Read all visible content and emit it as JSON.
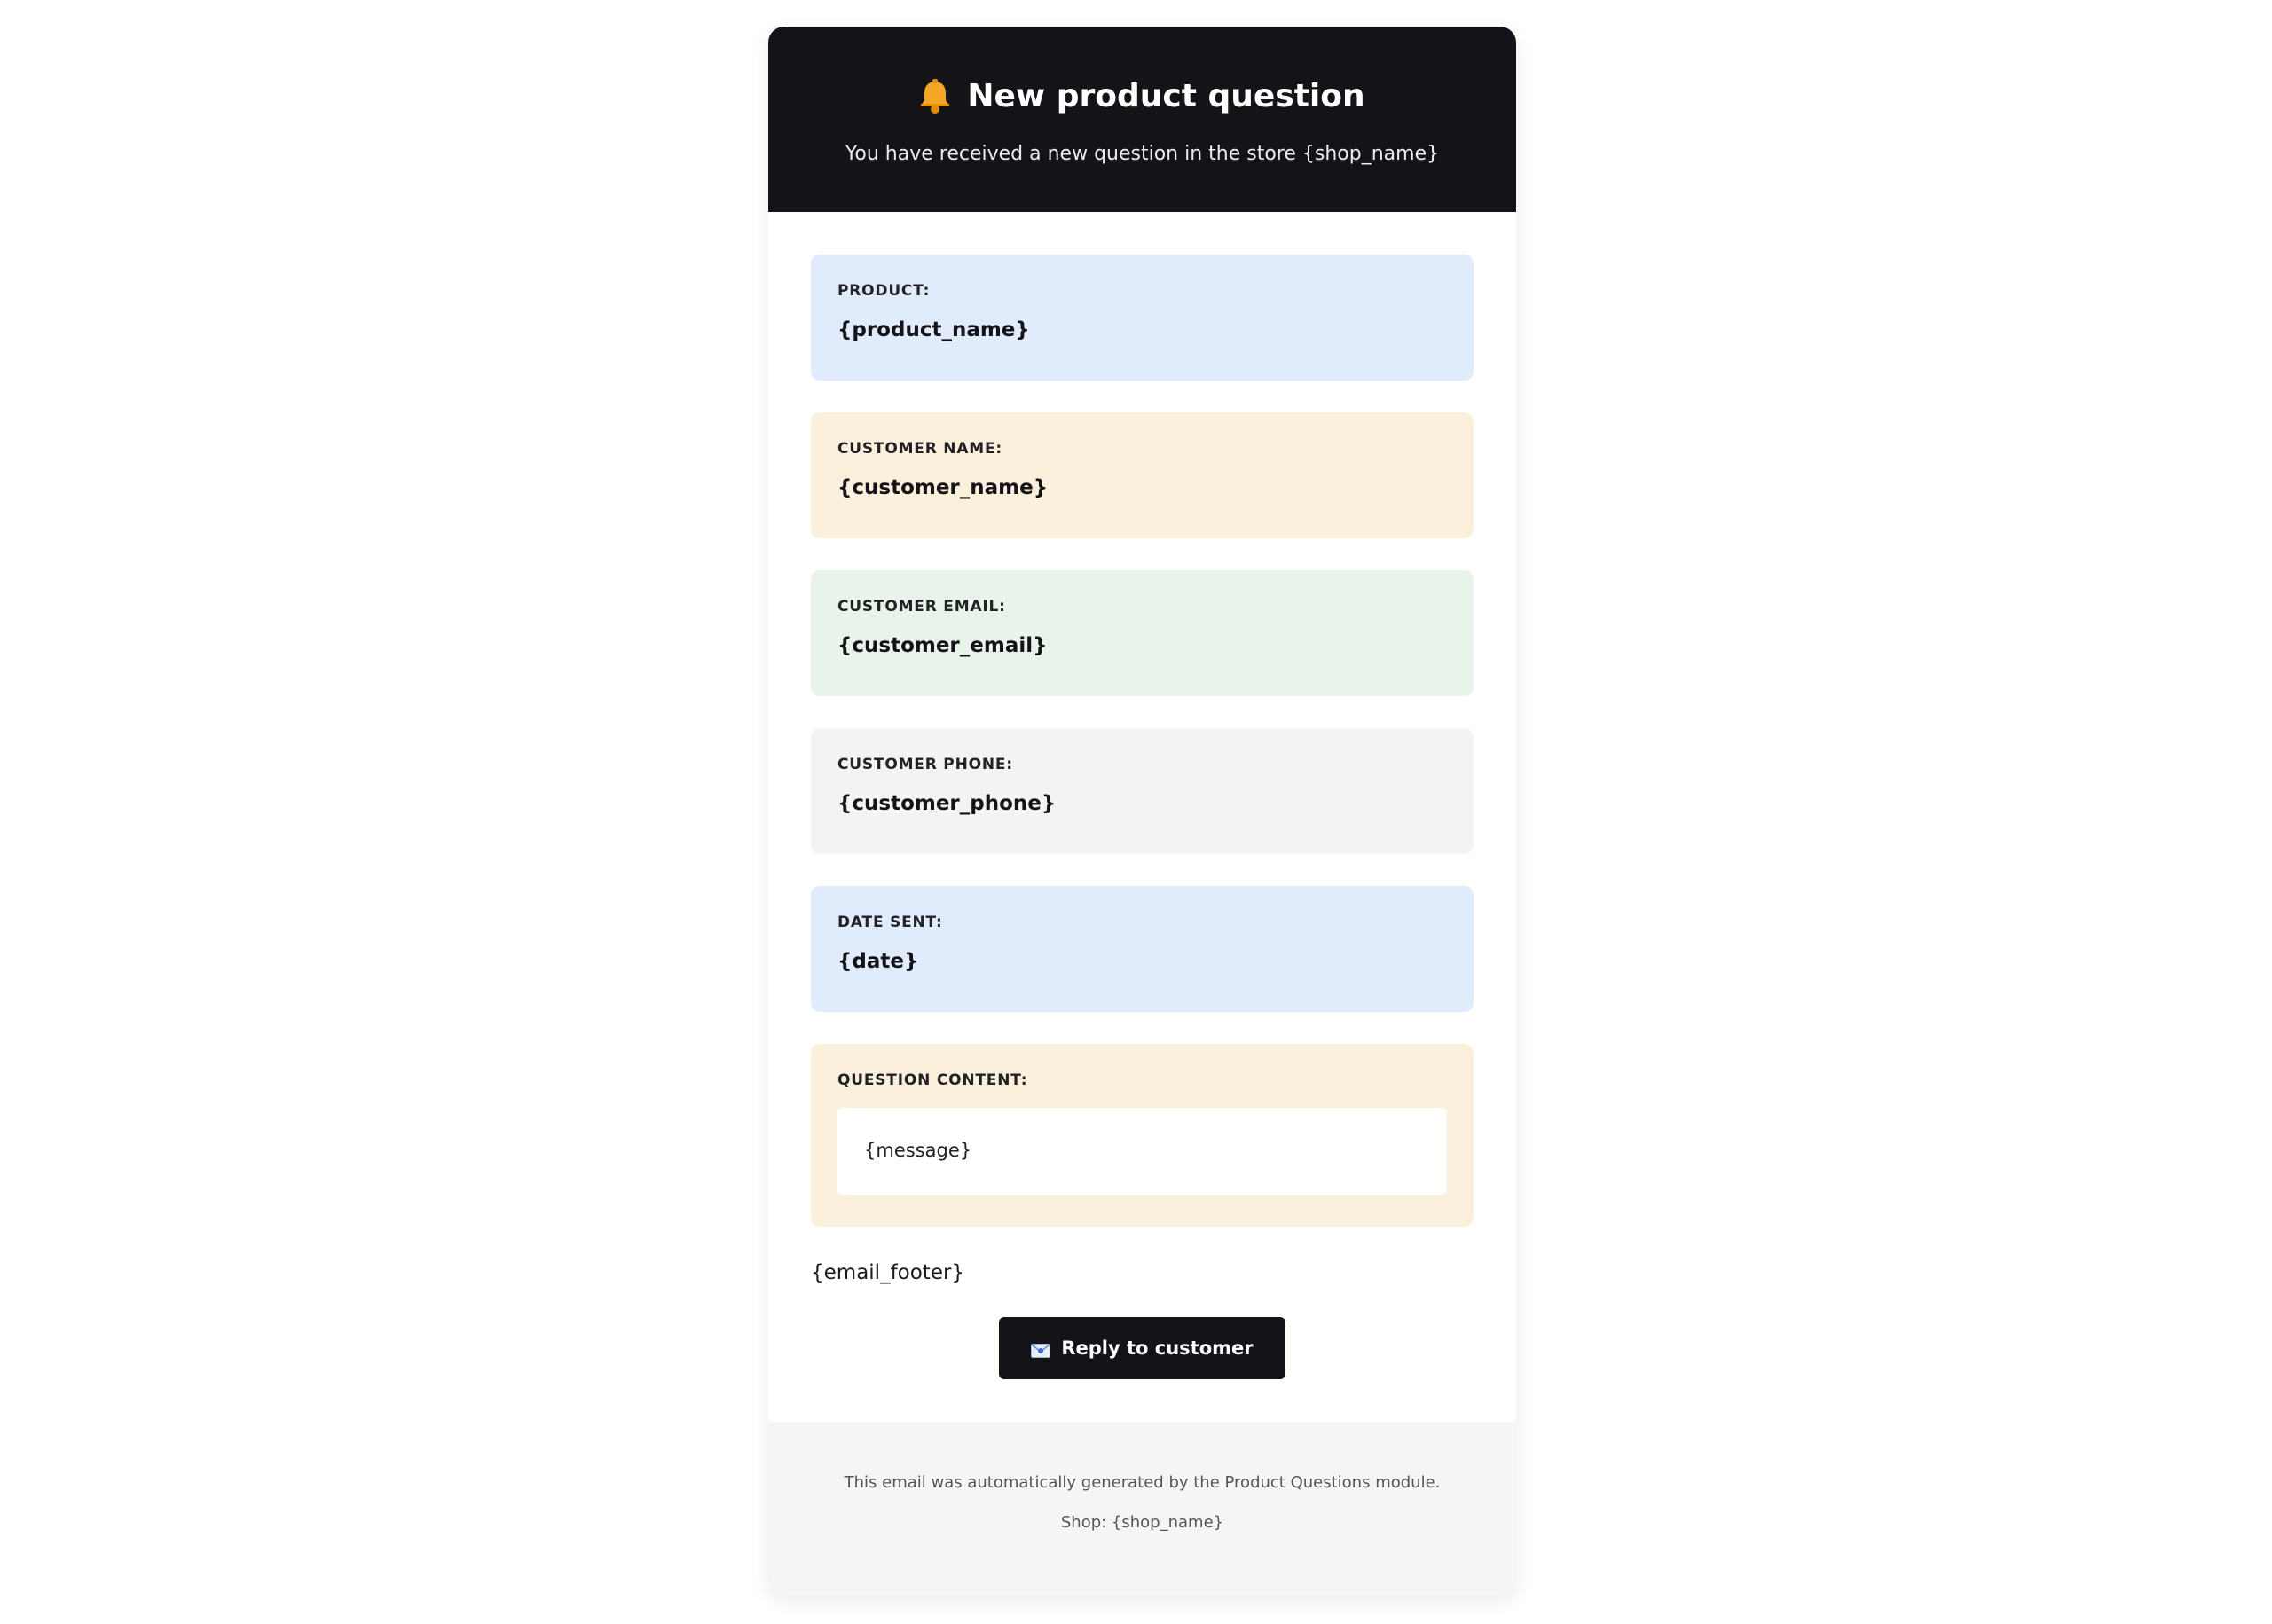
{
  "header": {
    "icon": "bell-icon",
    "title": "New product question",
    "subtitle": "You have received a new question in the store {shop_name}"
  },
  "fields": {
    "product": {
      "label": "PRODUCT:",
      "value": "{product_name}"
    },
    "customer_name": {
      "label": "CUSTOMER NAME:",
      "value": "{customer_name}"
    },
    "customer_email": {
      "label": "CUSTOMER EMAIL:",
      "value": "{customer_email}"
    },
    "customer_phone": {
      "label": "CUSTOMER PHONE:",
      "value": "{customer_phone}"
    },
    "date_sent": {
      "label": "DATE SENT:",
      "value": "{date}"
    },
    "question": {
      "label": "QUESTION CONTENT:",
      "value": "{message}"
    }
  },
  "email_footer": "{email_footer}",
  "reply_button": {
    "icon": "envelope-icon",
    "label": "Reply to customer"
  },
  "footer": {
    "line1": "This email was automatically generated by the Product Questions module.",
    "line2": "Shop: {shop_name}"
  },
  "colors": {
    "header_bg": "#141418",
    "blue_card": "#e0ebfb",
    "cream_card": "#faf0dc",
    "green_card": "#e8f3ea",
    "grey_card": "#f3f3f3",
    "footer_bg": "#f5f5f5"
  }
}
